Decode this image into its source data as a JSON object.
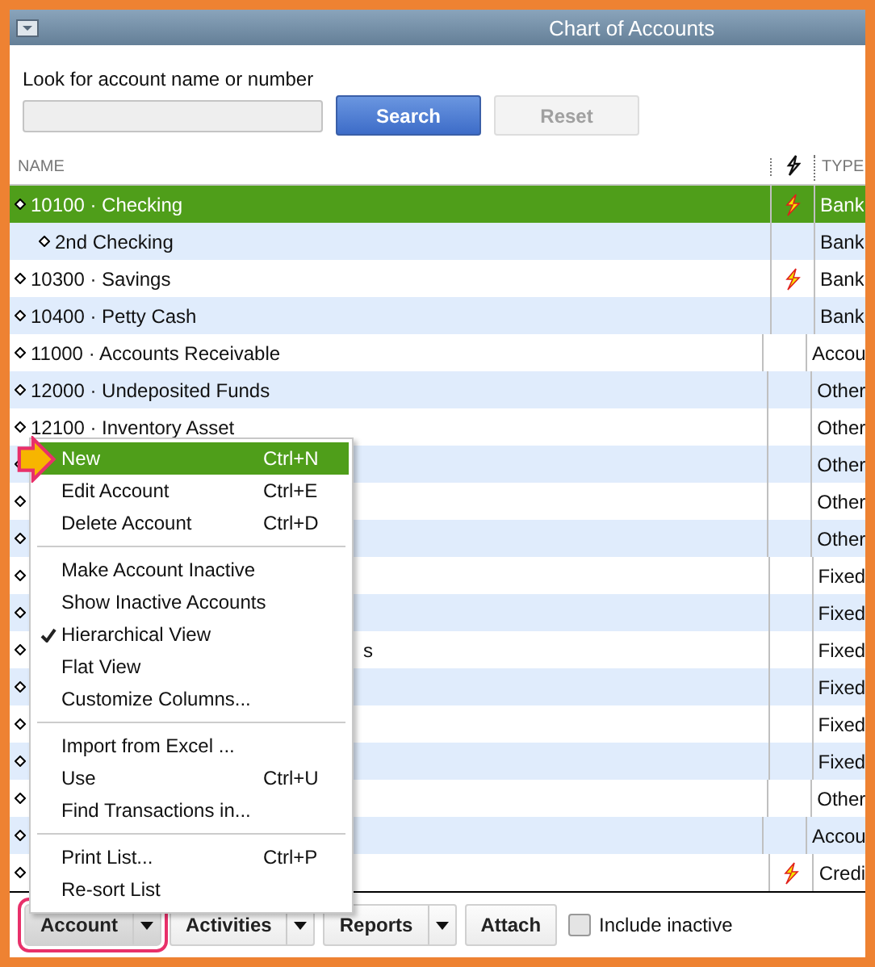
{
  "window": {
    "title": "Chart of Accounts"
  },
  "search": {
    "label": "Look for account name or number",
    "search_button": "Search",
    "reset_button": "Reset",
    "reset_disabled": true
  },
  "table": {
    "columns": [
      {
        "label": "NAME",
        "kind": "text"
      },
      {
        "kind": "icon"
      },
      {
        "label": "TYPE",
        "kind": "text"
      }
    ],
    "rows": [
      {
        "name": "10100 · Checking",
        "online": true,
        "type": "Bank",
        "selected": true,
        "children": [
          {
            "name": "2nd Checking",
            "online": false,
            "type": "Bank",
            "selected": false
          }
        ]
      },
      {
        "name": "10300 · Savings",
        "online": true,
        "type": "Bank",
        "selected": false
      },
      {
        "name": "10400 · Petty Cash",
        "online": false,
        "type": "Bank",
        "selected": false
      },
      {
        "name": "11000 · Accounts Receivable",
        "online": false,
        "type": "Accou",
        "selected": false
      },
      {
        "name": "12000 · Undeposited Funds",
        "online": false,
        "type": "Other",
        "selected": false
      },
      {
        "name": "12100 · Inventory Asset",
        "online": false,
        "type": "Other",
        "selected": false
      },
      {
        "online": false,
        "type": "Other",
        "selected": false
      },
      {
        "online": false,
        "type": "Other",
        "selected": false
      },
      {
        "online": false,
        "type": "Other",
        "selected": false
      },
      {
        "online": false,
        "type": "Fixed",
        "selected": false
      },
      {
        "online": false,
        "type": "Fixed",
        "selected": false
      },
      {
        "name": "s",
        "kind": "under_menu",
        "online": false,
        "type": "Fixed",
        "selected": false
      },
      {
        "online": false,
        "type": "Fixed",
        "selected": false
      },
      {
        "online": false,
        "type": "Fixed",
        "selected": false
      },
      {
        "online": false,
        "type": "Fixed",
        "selected": false
      },
      {
        "online": false,
        "type": "Other",
        "selected": false
      },
      {
        "online": false,
        "type": "Accou",
        "selected": false
      },
      {
        "online": true,
        "type": "Credi",
        "selected": false
      }
    ]
  },
  "menu": {
    "items": [
      {
        "kind": "item",
        "label": "New",
        "shortcut": "Ctrl+N",
        "selected": true,
        "checked": false
      },
      {
        "kind": "item",
        "label": "Edit Account",
        "shortcut": "Ctrl+E",
        "selected": false,
        "checked": false
      },
      {
        "kind": "item",
        "label": "Delete Account",
        "shortcut": "Ctrl+D",
        "selected": false,
        "checked": false
      },
      {
        "kind": "separator"
      },
      {
        "kind": "item",
        "label": "Make Account Inactive",
        "selected": false,
        "checked": false
      },
      {
        "kind": "item",
        "label": "Show Inactive Accounts",
        "selected": false,
        "checked": false
      },
      {
        "kind": "item",
        "label": "Hierarchical View",
        "selected": false,
        "checked": true
      },
      {
        "kind": "item",
        "label": "Flat View",
        "selected": false,
        "checked": false
      },
      {
        "kind": "item",
        "label": "Customize Columns...",
        "selected": false,
        "checked": false
      },
      {
        "kind": "separator"
      },
      {
        "kind": "item",
        "label": "Import from Excel ...",
        "selected": false,
        "checked": false
      },
      {
        "kind": "item",
        "label": "Use",
        "shortcut": "Ctrl+U",
        "selected": false,
        "checked": false
      },
      {
        "kind": "item",
        "label": "Find Transactions in...",
        "selected": false,
        "checked": false
      },
      {
        "kind": "separator"
      },
      {
        "kind": "item",
        "label": "Print List...",
        "shortcut": "Ctrl+P",
        "selected": false,
        "checked": false
      },
      {
        "kind": "item",
        "label": "Re-sort List",
        "selected": false,
        "checked": false
      }
    ]
  },
  "footer": {
    "buttons": [
      {
        "label": "Account",
        "dropdown": true,
        "highlighted": true
      },
      {
        "label": "Activities",
        "dropdown": true,
        "highlighted": false
      },
      {
        "label": "Reports",
        "dropdown": true,
        "highlighted": false
      },
      {
        "label": "Attach",
        "dropdown": false,
        "highlighted": false
      }
    ],
    "include_inactive": {
      "label": "Include inactive",
      "checked": false
    }
  }
}
